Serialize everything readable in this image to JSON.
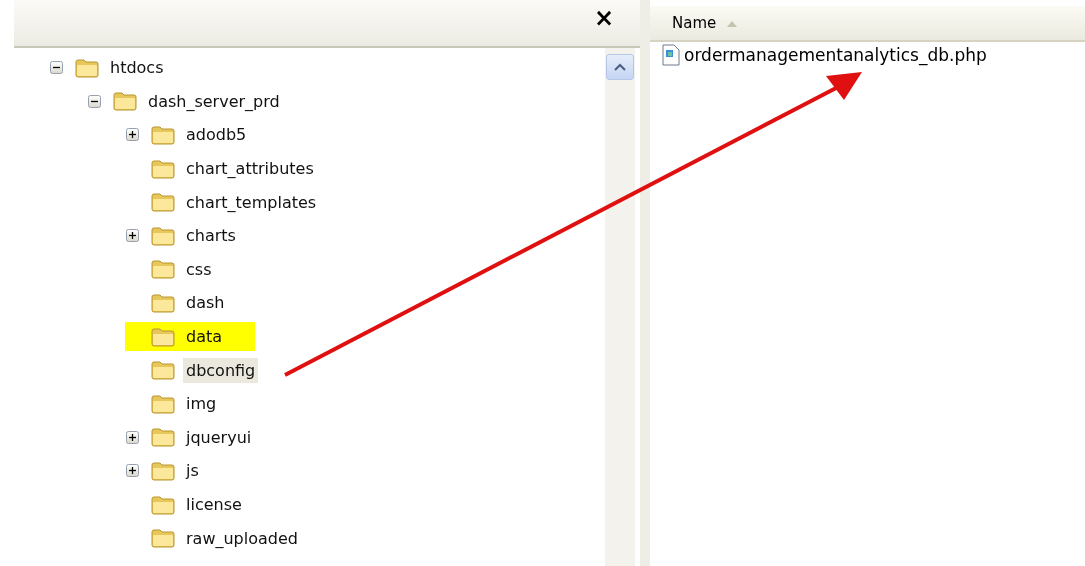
{
  "left_pane": {
    "close_button": "×"
  },
  "tree": [
    {
      "label": "htdocs",
      "expanded": true,
      "selected": false,
      "highlighted": false,
      "children": [
        {
          "label": "dash_server_prd",
          "expanded": true,
          "selected": false,
          "highlighted": false,
          "children": [
            {
              "label": "adodb5",
              "expanded": false,
              "selected": false,
              "highlighted": false
            },
            {
              "label": "chart_attributes",
              "selected": false,
              "highlighted": false
            },
            {
              "label": "chart_templates",
              "selected": false,
              "highlighted": false
            },
            {
              "label": "charts",
              "expanded": false,
              "selected": false,
              "highlighted": false
            },
            {
              "label": "css",
              "selected": false,
              "highlighted": false
            },
            {
              "label": "dash",
              "selected": false,
              "highlighted": false
            },
            {
              "label": "data",
              "selected": false,
              "highlighted": true
            },
            {
              "label": "dbconfig",
              "selected": true,
              "highlighted": false
            },
            {
              "label": "img",
              "selected": false,
              "highlighted": false
            },
            {
              "label": "jqueryui",
              "expanded": false,
              "selected": false,
              "highlighted": false
            },
            {
              "label": "js",
              "expanded": false,
              "selected": false,
              "highlighted": false
            },
            {
              "label": "license",
              "selected": false,
              "highlighted": false
            },
            {
              "label": "raw_uploaded",
              "selected": false,
              "highlighted": false
            }
          ]
        }
      ]
    }
  ],
  "file_list": {
    "columns": [
      {
        "label": "Name",
        "sorted": true
      }
    ],
    "files": [
      {
        "name": "ordermanagementanalytics_db.php"
      }
    ]
  }
}
